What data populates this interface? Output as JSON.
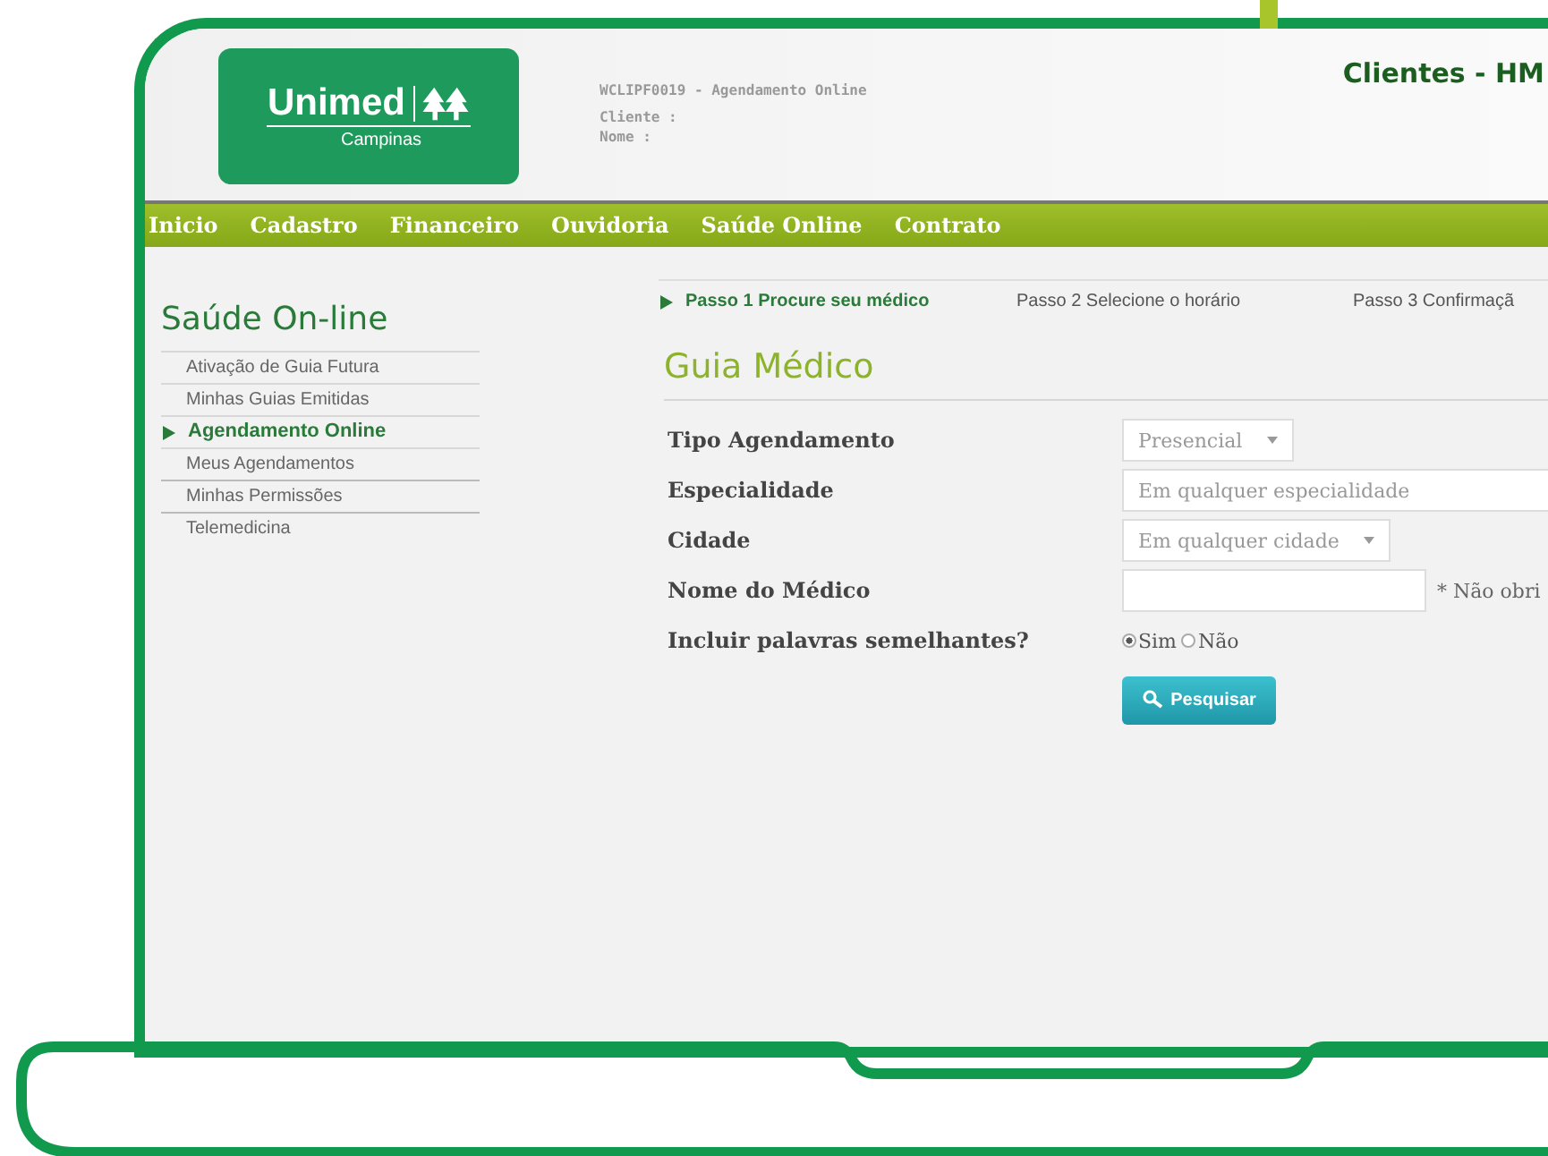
{
  "logo": {
    "name": "Unimed",
    "region": "Campinas"
  },
  "program_info": [
    "WCLIPF0019 - Agendamento Online",
    "Cliente :",
    "Nome :"
  ],
  "portal_title": "Clientes - HM",
  "menu": [
    {
      "label": "Inicio"
    },
    {
      "label": "Cadastro"
    },
    {
      "label": "Financeiro"
    },
    {
      "label": "Ouvidoria"
    },
    {
      "label": "Saúde Online"
    },
    {
      "label": "Contrato"
    }
  ],
  "sidebar": {
    "title": "Saúde On-line",
    "items": [
      {
        "label": "Ativação de Guia Futura",
        "selected": false
      },
      {
        "label": "Minhas Guias Emitidas",
        "selected": false
      },
      {
        "label": "Agendamento Online",
        "selected": true
      },
      {
        "label": "Meus Agendamentos",
        "selected": false
      },
      {
        "label": "Minhas Permissões",
        "selected": false
      },
      {
        "label": "Telemedicina",
        "selected": false
      }
    ]
  },
  "steps": [
    {
      "label": "Passo 1 Procure seu médico",
      "selected": true
    },
    {
      "label": "Passo 2 Selecione o horário",
      "selected": false
    },
    {
      "label": "Passo 3 Confirmaçã",
      "selected": false
    }
  ],
  "form": {
    "title": "Guia Médico",
    "fields": [
      {
        "kind": "select",
        "label": "Tipo Agendamento",
        "value": "Presencial"
      },
      {
        "kind": "text",
        "label": "Especialidade",
        "placeholder": "Em qualquer especialidade"
      },
      {
        "kind": "select",
        "label": "Cidade",
        "value": "Em qualquer cidade"
      },
      {
        "kind": "text",
        "label": "Nome do Médico",
        "note": "* Não obri"
      },
      {
        "kind": "radio",
        "label": "Incluir palavras semelhantes?",
        "options": [
          {
            "label": "Sim",
            "selected": true
          },
          {
            "label": "Não",
            "selected": false
          }
        ]
      }
    ],
    "button": "Pesquisar"
  }
}
